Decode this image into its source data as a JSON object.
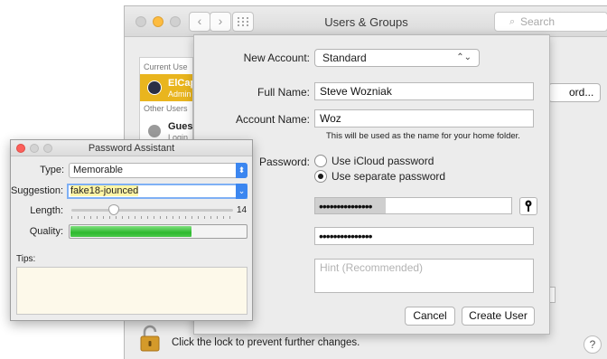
{
  "window": {
    "title": "Users & Groups",
    "search_placeholder": "Search",
    "nav_back": "‹",
    "nav_forward": "›",
    "grid_icon": "grid-icon"
  },
  "users_list": {
    "current_header": "Current Use",
    "current_user_name": "ElCap",
    "current_user_role": "Admin",
    "other_header": "Other Users",
    "guest_name": "Gues",
    "guest_sub": "Login"
  },
  "background": {
    "partial_button": "ord...",
    "lock_text": "Click the lock to prevent further changes.",
    "help": "?"
  },
  "new_account": {
    "new_account_label": "New Account:",
    "account_type": "Standard",
    "full_name_label": "Full Name:",
    "full_name_value": "Steve Wozniak",
    "account_name_label": "Account Name:",
    "account_name_value": "Woz",
    "account_name_hint": "This will be used as the name for your home folder.",
    "password_label": "Password:",
    "radio_icloud": "Use iCloud password",
    "radio_separate": "Use separate password",
    "selected_radio": "Use separate password",
    "password_masked": "•••••••••••••••",
    "verify_masked": "•••••••••••••••",
    "hint_placeholder": "Hint (Recommended)",
    "cancel_label": "Cancel",
    "create_label": "Create User"
  },
  "password_assistant": {
    "title": "Password Assistant",
    "type_label": "Type:",
    "type_value": "Memorable",
    "suggestion_label": "Suggestion:",
    "suggestion_value": "fake18-jounced",
    "length_label": "Length:",
    "length_value": "14",
    "length_min": 8,
    "length_max": 31,
    "quality_label": "Quality:",
    "quality_fraction": 0.69,
    "tips_label": "Tips:"
  },
  "colors": {
    "selection_yellow": "#e9b51e",
    "accent_blue": "#3b86f0",
    "quality_green": "#2fb92f",
    "close_red": "#fc605b",
    "minimize_yellow": "#fdbc40"
  }
}
